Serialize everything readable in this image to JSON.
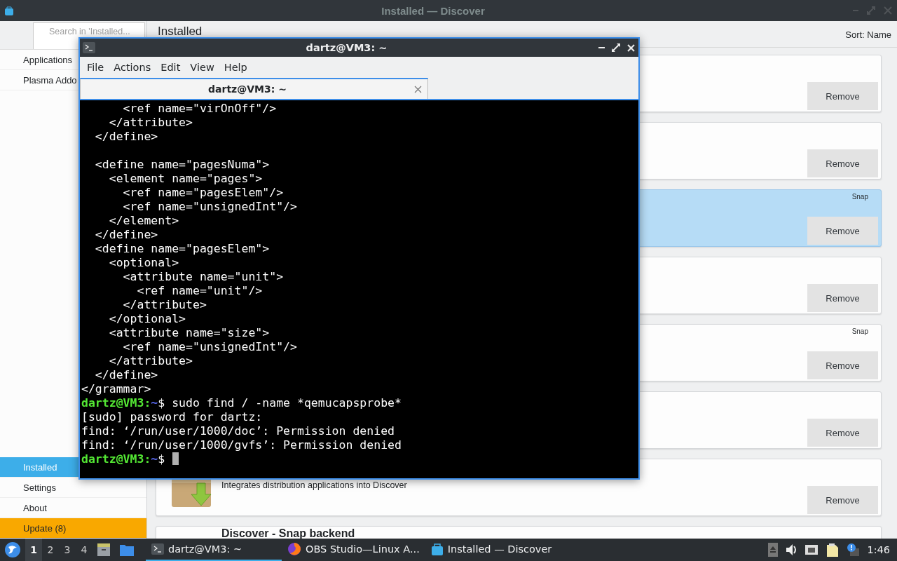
{
  "window": {
    "title": "Installed — Discover"
  },
  "sidebar": {
    "search": {
      "placeholder": "Search in 'Installed..."
    },
    "items": [
      {
        "label": "Applications",
        "selected": false
      },
      {
        "label": "Plasma Addo",
        "selected": false
      }
    ],
    "bottom_items": [
      {
        "label": "Installed",
        "selected": true,
        "kind": "nav"
      },
      {
        "label": "Settings",
        "selected": false,
        "kind": "nav"
      },
      {
        "label": "About",
        "selected": false,
        "kind": "nav"
      },
      {
        "label": "Update (8)",
        "selected": false,
        "kind": "update"
      }
    ]
  },
  "header": {
    "title": "Installed",
    "sort": "Sort: Name"
  },
  "cards": [
    {
      "selected": false,
      "button": "Remove"
    },
    {
      "selected": false,
      "button": "Remove"
    },
    {
      "selected": true,
      "source": "Snap",
      "button": "Remove"
    },
    {
      "selected": false,
      "button": "Remove"
    },
    {
      "selected": false,
      "source": "Snap",
      "button": "Remove"
    },
    {
      "selected": false,
      "button": "Remove"
    },
    {
      "selected": false,
      "description": "Integrates distribution applications into Discover",
      "button": "Remove"
    },
    {
      "selected": false,
      "title": "Discover - Snap backend"
    }
  ],
  "terminal": {
    "title": "dartz@VM3: ~",
    "menu": [
      "File",
      "Actions",
      "Edit",
      "View",
      "Help"
    ],
    "tabs": [
      {
        "label": "dartz@VM3: ~",
        "selected": true
      }
    ],
    "lines": [
      {
        "kind": "text",
        "text": "      <ref name=\"virOnOff\"/>"
      },
      {
        "kind": "text",
        "text": "    </attribute>"
      },
      {
        "kind": "text",
        "text": "  </define>"
      },
      {
        "kind": "blank"
      },
      {
        "kind": "text",
        "text": "  <define name=\"pagesNuma\">"
      },
      {
        "kind": "text",
        "text": "    <element name=\"pages\">"
      },
      {
        "kind": "text",
        "text": "      <ref name=\"pagesElem\"/>"
      },
      {
        "kind": "text",
        "text": "      <ref name=\"unsignedInt\"/>"
      },
      {
        "kind": "text",
        "text": "    </element>"
      },
      {
        "kind": "text",
        "text": "  </define>"
      },
      {
        "kind": "text",
        "text": "  <define name=\"pagesElem\">"
      },
      {
        "kind": "text",
        "text": "    <optional>"
      },
      {
        "kind": "text",
        "text": "      <attribute name=\"unit\">"
      },
      {
        "kind": "text",
        "text": "        <ref name=\"unit\"/>"
      },
      {
        "kind": "text",
        "text": "      </attribute>"
      },
      {
        "kind": "text",
        "text": "    </optional>"
      },
      {
        "kind": "text",
        "text": "    <attribute name=\"size\">"
      },
      {
        "kind": "text",
        "text": "      <ref name=\"unsignedInt\"/>"
      },
      {
        "kind": "text",
        "text": "    </attribute>"
      },
      {
        "kind": "text",
        "text": "  </define>"
      },
      {
        "kind": "text",
        "text": "</grammar>"
      },
      {
        "kind": "prompt",
        "user": "dartz@VM3:",
        "path": "~",
        "command": "$ sudo find / -name *qemucapsprobe*"
      },
      {
        "kind": "text",
        "text": "[sudo] password for dartz:"
      },
      {
        "kind": "text",
        "text": "find: ‘/run/user/1000/doc’: Permission denied"
      },
      {
        "kind": "text",
        "text": "find: ‘/run/user/1000/gvfs’: Permission denied"
      },
      {
        "kind": "prompt",
        "user": "dartz@VM3:",
        "path": "~",
        "command": "$",
        "cursor": true
      }
    ]
  },
  "taskbar": {
    "desktops": [
      {
        "label": "1",
        "selected": true
      },
      {
        "label": "2",
        "selected": false
      },
      {
        "label": "3",
        "selected": false
      },
      {
        "label": "4",
        "selected": false
      }
    ],
    "tasks": [
      {
        "label": "dartz@VM3: ~",
        "selected": true
      },
      {
        "label": "OBS Studio—Linux A...",
        "selected": false
      },
      {
        "label": "Installed — Discover",
        "selected": false
      }
    ],
    "clock": "1:46"
  }
}
